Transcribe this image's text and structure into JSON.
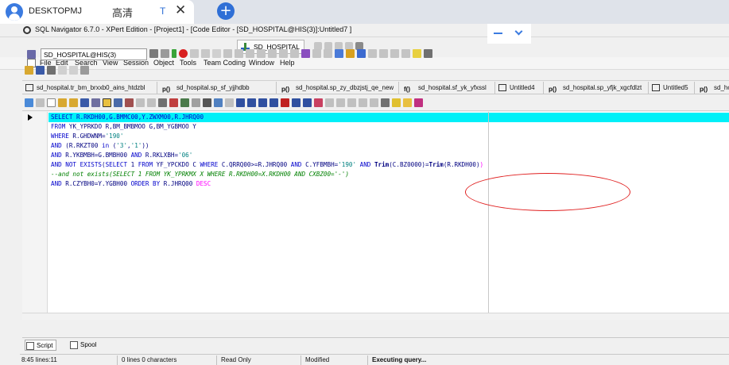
{
  "remote_desktop": {
    "machine_name": "DESKTOPMJ",
    "quality_label": "高清",
    "t_label": "T",
    "close_glyph": "✕",
    "add_glyph": "+"
  },
  "window": {
    "title": "SQL Navigator 6.7.0 - XPert Edition - [Project1] - [Code Editor - [SD_HOSPITAL@HIS(3)]:Untitled7 ]"
  },
  "connection_button": {
    "label": "SD_HOSPITAL"
  },
  "menu": [
    {
      "label": "File"
    },
    {
      "label": "Edit"
    },
    {
      "label": "Search"
    },
    {
      "label": "View"
    },
    {
      "label": "Session"
    },
    {
      "label": "Object"
    },
    {
      "label": "Tools"
    },
    {
      "label": "Team Coding"
    },
    {
      "label": "Window"
    },
    {
      "label": "Help"
    }
  ],
  "session_combo": {
    "value": "SD_HOSPITAL@HIS(3)"
  },
  "editor_tabs": [
    {
      "icon": "",
      "label": "sd_hospital.tr_bm_brxxb0_ains_htdzbl"
    },
    {
      "icon": "p()",
      "label": "sd_hospital.sp_sf_yjjhdbb"
    },
    {
      "icon": "p()",
      "label": "sd_hospital.sp_zy_dbzjstj_qe_new"
    },
    {
      "icon": "f()",
      "label": "sd_hospital.sf_yk_yfxssl"
    },
    {
      "icon": "",
      "label": "Untitled4"
    },
    {
      "icon": "p()",
      "label": "sd_hospital.sp_yfjk_xgcfdlzt"
    },
    {
      "icon": "",
      "label": "Untitled5"
    },
    {
      "icon": "p()",
      "label": "sd_hospital.s"
    }
  ],
  "code": {
    "line1": "SELECT R.RKDH00,G.BMMC00,Y.ZWXM00,R.JHRQ00",
    "line2_kw": "FROM",
    "line2": " YK_YPRKDO R,BM_BMBMOO G,BM_YGBMOO Y",
    "line3_kw": "WHERE",
    "line3_a": " R.GHDWNM=",
    "line3_str": "'190'",
    "line4_kw": "AND",
    "line4_a": " (R.RKZT00 ",
    "line4_in": "in",
    "line4_b": " (",
    "line4_s1": "'3'",
    "line4_c": ",",
    "line4_s2": "'1'",
    "line4_d": "))",
    "line5_kw": "AND",
    "line5_a": " R.YKBMBH=G.BMBH00 ",
    "line5_kw2": "AND",
    "line5_b": " R.RKLXBH=",
    "line5_str": "'06'",
    "line6_kw": "AND NOT EXISTS",
    "line6_a": "(",
    "line6_kw2": "SELECT",
    "line6_b": " 1 ",
    "line6_kw3": "FROM",
    "line6_c": " YF_YPCKDO C ",
    "line6_kw4": "WHERE",
    "line6_d": " C.QRRQ00>=R.JHRQ00 ",
    "line6_kw5": "AND",
    "line6_e": " C.YFBMBH=",
    "line6_str": "'190'",
    "line6_f": " ",
    "line6_kw6": "AND",
    "line6_fn": " Trim",
    "line6_g": "(C.BZ0000)=",
    "line6_fn2": "Trim",
    "line6_h": "(R.RKDH00)",
    "line6_paren": ")",
    "line7": "--and not exists(SELECT 1 FROM YK_YPRKMX X WHERE R.RKDH00=X.RKDH00 AND CXBZ00='-')",
    "line8_kw": "AND",
    "line8_a": " R.CZYBH0=Y.YGBH00 ",
    "line8_kw2": "ORDER BY",
    "line8_b": " R.JHRQ00 ",
    "line8_kw3": "DESC"
  },
  "bottom_tabs": [
    {
      "label": "Script"
    },
    {
      "label": "Spool"
    }
  ],
  "status": {
    "position": "8:45 lines:11",
    "lines_info": "0 lines 0 characters",
    "readonly": "Read Only",
    "modified": "Modified",
    "executing": "Executing query..."
  },
  "colors": {
    "highlight": "#00f0f8",
    "keyword": "#0000cc",
    "string": "#008080",
    "comment": "#008000",
    "annotation": "#e02020"
  }
}
